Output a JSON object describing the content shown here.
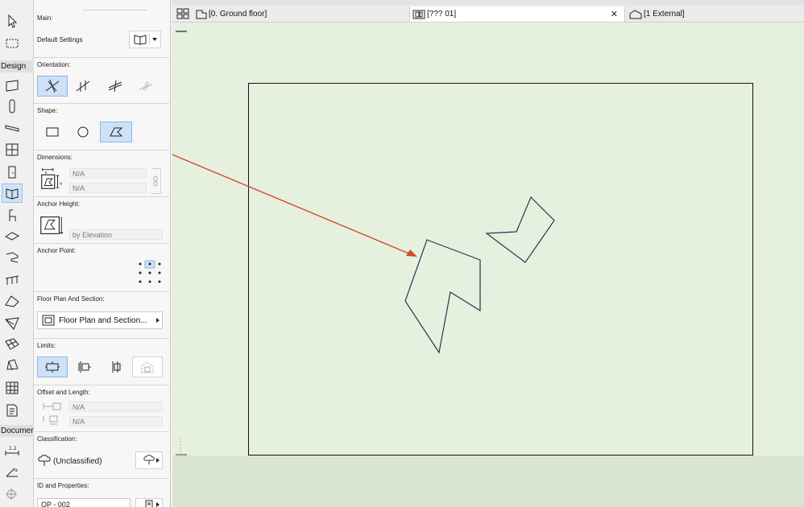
{
  "toolbox": {
    "group_design": "Design",
    "group_document": "Documen"
  },
  "infobox": {
    "main": {
      "label": "Main:",
      "default_settings": "Default Settings"
    },
    "orientation": {
      "label": "Orientation:"
    },
    "shape": {
      "label": "Shape:"
    },
    "dimensions": {
      "label": "Dimensions:",
      "width_value": "N/A",
      "height_value": "N/A"
    },
    "anchor_height": {
      "label": "Anchor Height:",
      "value": "by Elevation"
    },
    "anchor_point": {
      "label": "Anchor Point:"
    },
    "floor_plan": {
      "label": "Floor Plan And Section:",
      "value": "Floor Plan and Section..."
    },
    "limits": {
      "label": "Limits:"
    },
    "offset": {
      "label": "Offset and Length:",
      "offset_value": "N/A",
      "length_value": "N/A"
    },
    "classification": {
      "label": "Classification:",
      "value": "(Unclassified)"
    },
    "id": {
      "label": "ID and Properties:",
      "value": "OP - 002"
    }
  },
  "tabs": [
    {
      "label": "[0. Ground floor]",
      "icon": "floor-plan-icon"
    },
    {
      "label": "[??? 01]",
      "icon": "window-view-icon"
    },
    {
      "label": "[1 External]",
      "icon": "house-elevation-icon"
    }
  ],
  "colors": {
    "canvas_bg": "#e6f0df",
    "selected_bg": "#cde1f7",
    "annotation_arrow": "#d04a2c",
    "shape_stroke": "#2a3550"
  }
}
